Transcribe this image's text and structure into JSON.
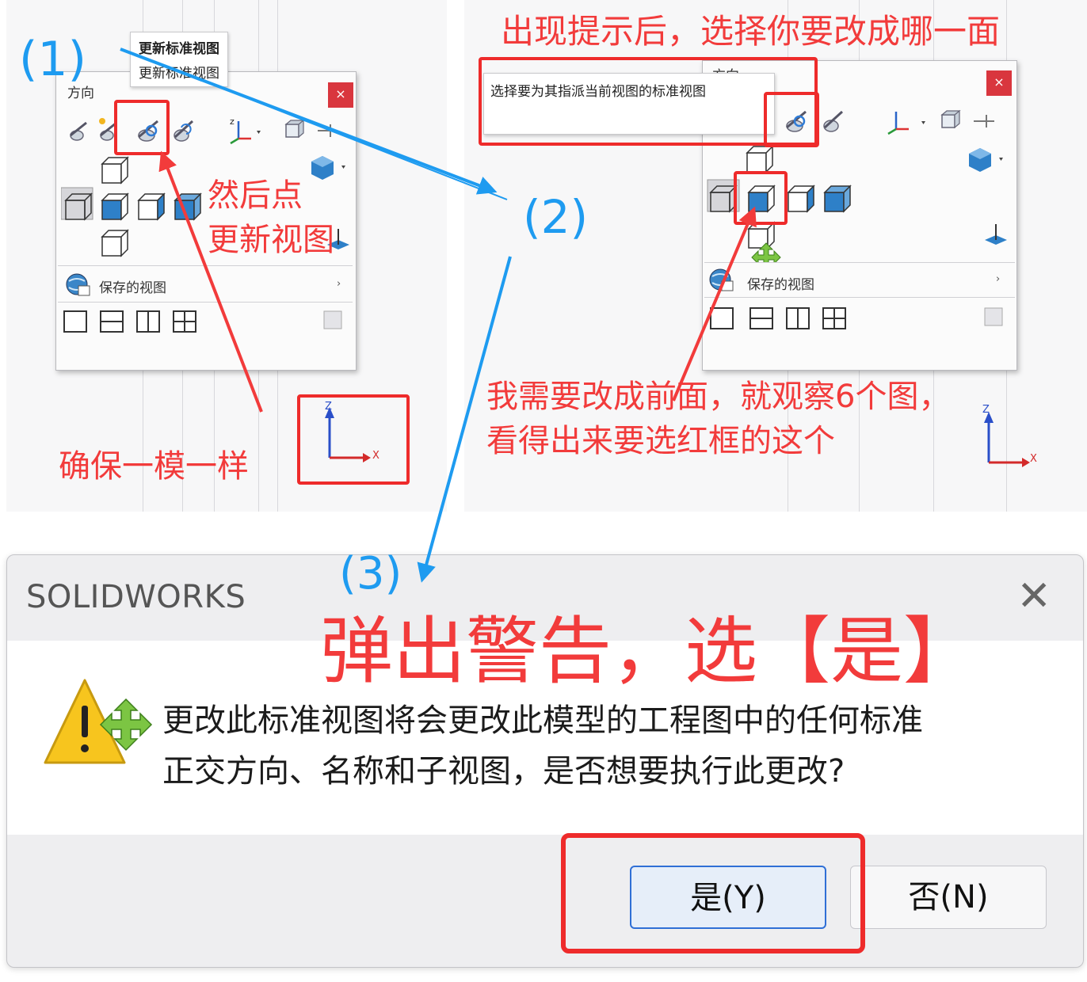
{
  "left_panel": {
    "popup_title": "方向",
    "tooltip_title": "更新标准视图",
    "tooltip_desc": "更新标准视图",
    "close_label": "×",
    "saved_views_label": "保存的视图",
    "submenu_chevron": "›"
  },
  "right_panel": {
    "popup_title_partial": "方向",
    "tooltip_text": "选择要为其指派当前视图的标准视图",
    "close_label": "×",
    "saved_views_label": "保存的视图",
    "submenu_chevron": "›"
  },
  "triad": {
    "z_label": "Z",
    "x_label": "X"
  },
  "annotations": {
    "step1": "(1)",
    "step2": "(2)",
    "step3": "(3)",
    "top_right_hint": "出现提示后，选择你要改成哪一面",
    "then_click_line1": "然后点",
    "then_click_line2": "更新视图",
    "ensure_same": "确保一模一样",
    "need_front_line1": "我需要改成前面，就观察6个图，",
    "need_front_line2": "看得出来要选红框的这个",
    "warning_hint": "弹出警告，选【是】"
  },
  "dialog": {
    "title": "SOLIDWORKS",
    "close_label": "✕",
    "message_line1": "更改此标准视图将会更改此模型的工程图中的任何标准",
    "message_line2": "正交方向、名称和子视图，是否想要执行此更改?",
    "yes_label": "是(Y)",
    "no_label": "否(N)"
  },
  "colors": {
    "annotation_red": "#f23b3b",
    "annotation_blue": "#1e9bf0",
    "close_red": "#d9363e",
    "primary_button_border": "#2f6fd6",
    "primary_button_bg": "#e6eef9"
  }
}
